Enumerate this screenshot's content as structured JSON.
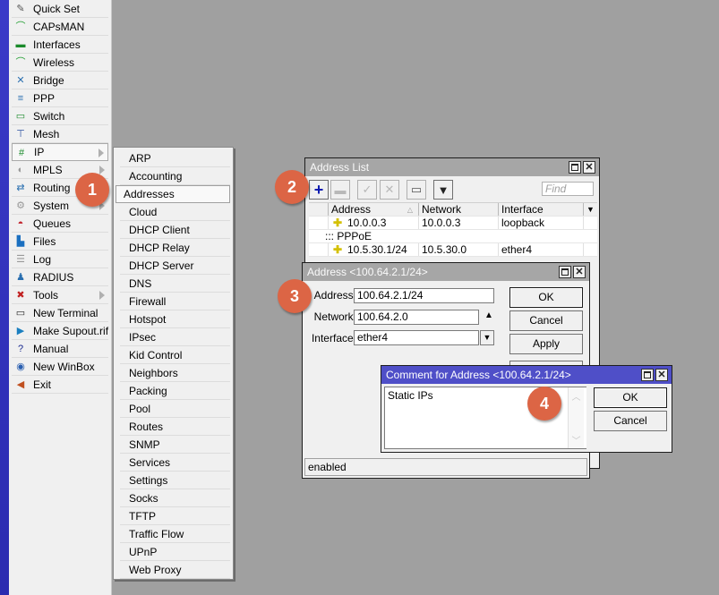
{
  "main_menu": {
    "items": [
      {
        "label": "Quick Set",
        "icon": "wand-icon",
        "glyph": "✎",
        "color": "#555"
      },
      {
        "label": "CAPsMAN",
        "icon": "antenna-icon",
        "glyph": "⌒",
        "color": "#1a9b2b"
      },
      {
        "label": "Interfaces",
        "icon": "network-card-icon",
        "glyph": "▬",
        "color": "#1a8a2b"
      },
      {
        "label": "Wireless",
        "icon": "wireless-icon",
        "glyph": "⌒",
        "color": "#1a9b2b"
      },
      {
        "label": "Bridge",
        "icon": "bridge-icon",
        "glyph": "✕",
        "color": "#2a6fb0"
      },
      {
        "label": "PPP",
        "icon": "ppp-icon",
        "glyph": "≡",
        "color": "#2a6fb0"
      },
      {
        "label": "Switch",
        "icon": "switch-icon",
        "glyph": "▭",
        "color": "#1a8a2b"
      },
      {
        "label": "Mesh",
        "icon": "mesh-icon",
        "glyph": "⊤",
        "color": "#2a4fa0"
      },
      {
        "label": "IP",
        "icon": "ip-icon",
        "glyph": "#",
        "color": "#1a8a2b",
        "submenu": true,
        "active": true
      },
      {
        "label": "MPLS",
        "icon": "mpls-icon",
        "glyph": "◐",
        "color": "#999",
        "submenu": true
      },
      {
        "label": "Routing",
        "icon": "routing-icon",
        "glyph": "⇄",
        "color": "#2a6fb0",
        "submenu": true
      },
      {
        "label": "System",
        "icon": "gear-icon",
        "glyph": "⚙",
        "color": "#999",
        "submenu": true
      },
      {
        "label": "Queues",
        "icon": "queues-icon",
        "glyph": "◓",
        "color": "#c0202a"
      },
      {
        "label": "Files",
        "icon": "folder-icon",
        "glyph": "▙",
        "color": "#1a6fc0"
      },
      {
        "label": "Log",
        "icon": "log-icon",
        "glyph": "☰",
        "color": "#999"
      },
      {
        "label": "RADIUS",
        "icon": "radius-icon",
        "glyph": "♟",
        "color": "#2a6fb0"
      },
      {
        "label": "Tools",
        "icon": "tools-icon",
        "glyph": "✖",
        "color": "#c02020",
        "submenu": true
      },
      {
        "label": "New Terminal",
        "icon": "terminal-icon",
        "glyph": "▭",
        "color": "#222"
      },
      {
        "label": "Make Supout.rif",
        "icon": "supout-icon",
        "glyph": "▶",
        "color": "#1a7fc0"
      },
      {
        "label": "Manual",
        "icon": "manual-icon",
        "glyph": "?",
        "color": "#1a2a90"
      },
      {
        "label": "New WinBox",
        "icon": "winbox-icon",
        "glyph": "◉",
        "color": "#2a5fb0"
      },
      {
        "label": "Exit",
        "icon": "exit-icon",
        "glyph": "◀",
        "color": "#c05020"
      }
    ]
  },
  "ip_submenu": {
    "items": [
      "ARP",
      "Accounting",
      "Addresses",
      "Cloud",
      "DHCP Client",
      "DHCP Relay",
      "DHCP Server",
      "DNS",
      "Firewall",
      "Hotspot",
      "IPsec",
      "Kid Control",
      "Neighbors",
      "Packing",
      "Pool",
      "Routes",
      "SNMP",
      "Services",
      "Settings",
      "Socks",
      "TFTP",
      "Traffic Flow",
      "UPnP",
      "Web Proxy"
    ],
    "active_index": 2
  },
  "badges": [
    "1",
    "2",
    "3",
    "4"
  ],
  "address_list": {
    "title": "Address List",
    "find_placeholder": "Find",
    "columns": [
      "Address",
      "Network",
      "Interface"
    ],
    "rows": [
      {
        "type": "row",
        "address": "10.0.0.3",
        "network": "10.0.0.3",
        "interface": "loopback"
      },
      {
        "type": "section",
        "label": "::: PPPoE"
      },
      {
        "type": "row",
        "address": "10.5.30.1/24",
        "network": "10.5.30.0",
        "interface": "ether4"
      }
    ]
  },
  "address_dialog": {
    "title": "Address <100.64.2.1/24>",
    "fields": {
      "address_label": "Address:",
      "address_value": "100.64.2.1/24",
      "network_label": "Network:",
      "network_value": "100.64.2.0",
      "interface_label": "Interface:",
      "interface_value": "ether4"
    },
    "buttons": {
      "ok": "OK",
      "cancel": "Cancel",
      "apply": "Apply"
    },
    "status": "enabled"
  },
  "comment_dialog": {
    "title": "Comment for Address <100.64.2.1/24>",
    "comment": "Static IPs",
    "buttons": {
      "ok": "OK",
      "cancel": "Cancel"
    }
  }
}
